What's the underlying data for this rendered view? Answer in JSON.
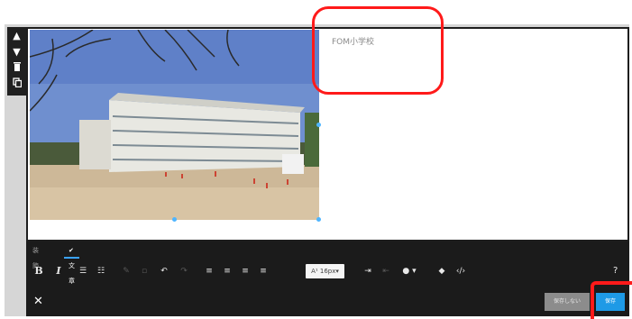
{
  "side_toolbar": {
    "icons": [
      "chevron-up-icon",
      "chevron-down-icon",
      "trash-icon",
      "copy-icon"
    ]
  },
  "content": {
    "text_block": "FOM小学校"
  },
  "editor_tabs": {
    "design": "装飾",
    "text": "✔ 文章"
  },
  "format_toolbar": {
    "bold": "B",
    "italic": "I",
    "font_size": "A¹ 16px▾",
    "help": "?"
  },
  "actions": {
    "close": "✕",
    "no_save": "保存しない",
    "save": "保存"
  },
  "colors": {
    "accent": "#1e9ae6",
    "highlight": "#ff1a1a",
    "toolbar_bg": "#1b1b1b"
  }
}
